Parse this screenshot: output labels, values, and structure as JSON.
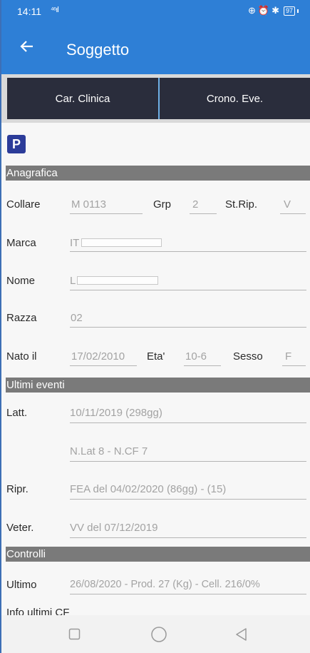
{
  "status_bar": {
    "time": "14:11",
    "signal": "ᴴᴵ┆ıl",
    "battery": "97"
  },
  "app_bar": {
    "back_icon": "arrow-left-icon",
    "title": "Soggetto"
  },
  "tabs": [
    {
      "label": "Car. Clinica"
    },
    {
      "label": "Crono. Eve."
    }
  ],
  "badge": {
    "label": "P"
  },
  "anagrafica": {
    "header": "Anagrafica",
    "collare": {
      "label": "Collare",
      "value": "M 0113"
    },
    "grp": {
      "label": "Grp",
      "value": "2"
    },
    "strip": {
      "label": "St.Rip.",
      "value": "V"
    },
    "marca": {
      "label": "Marca",
      "value": "IT"
    },
    "nome": {
      "label": "Nome",
      "value": "L"
    },
    "razza": {
      "label": "Razza",
      "value": "02"
    },
    "nato": {
      "label": "Nato il",
      "value": "17/02/2010"
    },
    "eta": {
      "label": "Eta'",
      "value": "10-6"
    },
    "sesso": {
      "label": "Sesso",
      "value": "F"
    }
  },
  "ultimi_eventi": {
    "header": "Ultimi eventi",
    "latt": {
      "label": "Latt.",
      "value": "10/11/2019 (298gg)",
      "value2": "N.Lat 8 - N.CF 7"
    },
    "ripr": {
      "label": "Ripr.",
      "value": "FEA del 04/02/2020 (86gg) - (15)"
    },
    "veter": {
      "label": "Veter.",
      "value": "VV del 07/12/2019"
    }
  },
  "controlli": {
    "header": "Controlli",
    "ultimo": {
      "label": "Ultimo",
      "value": "26/08/2020 - Prod. 27 (Kg) - Cell. 216/0%"
    },
    "info": {
      "label": "Info ultimi CF"
    }
  }
}
